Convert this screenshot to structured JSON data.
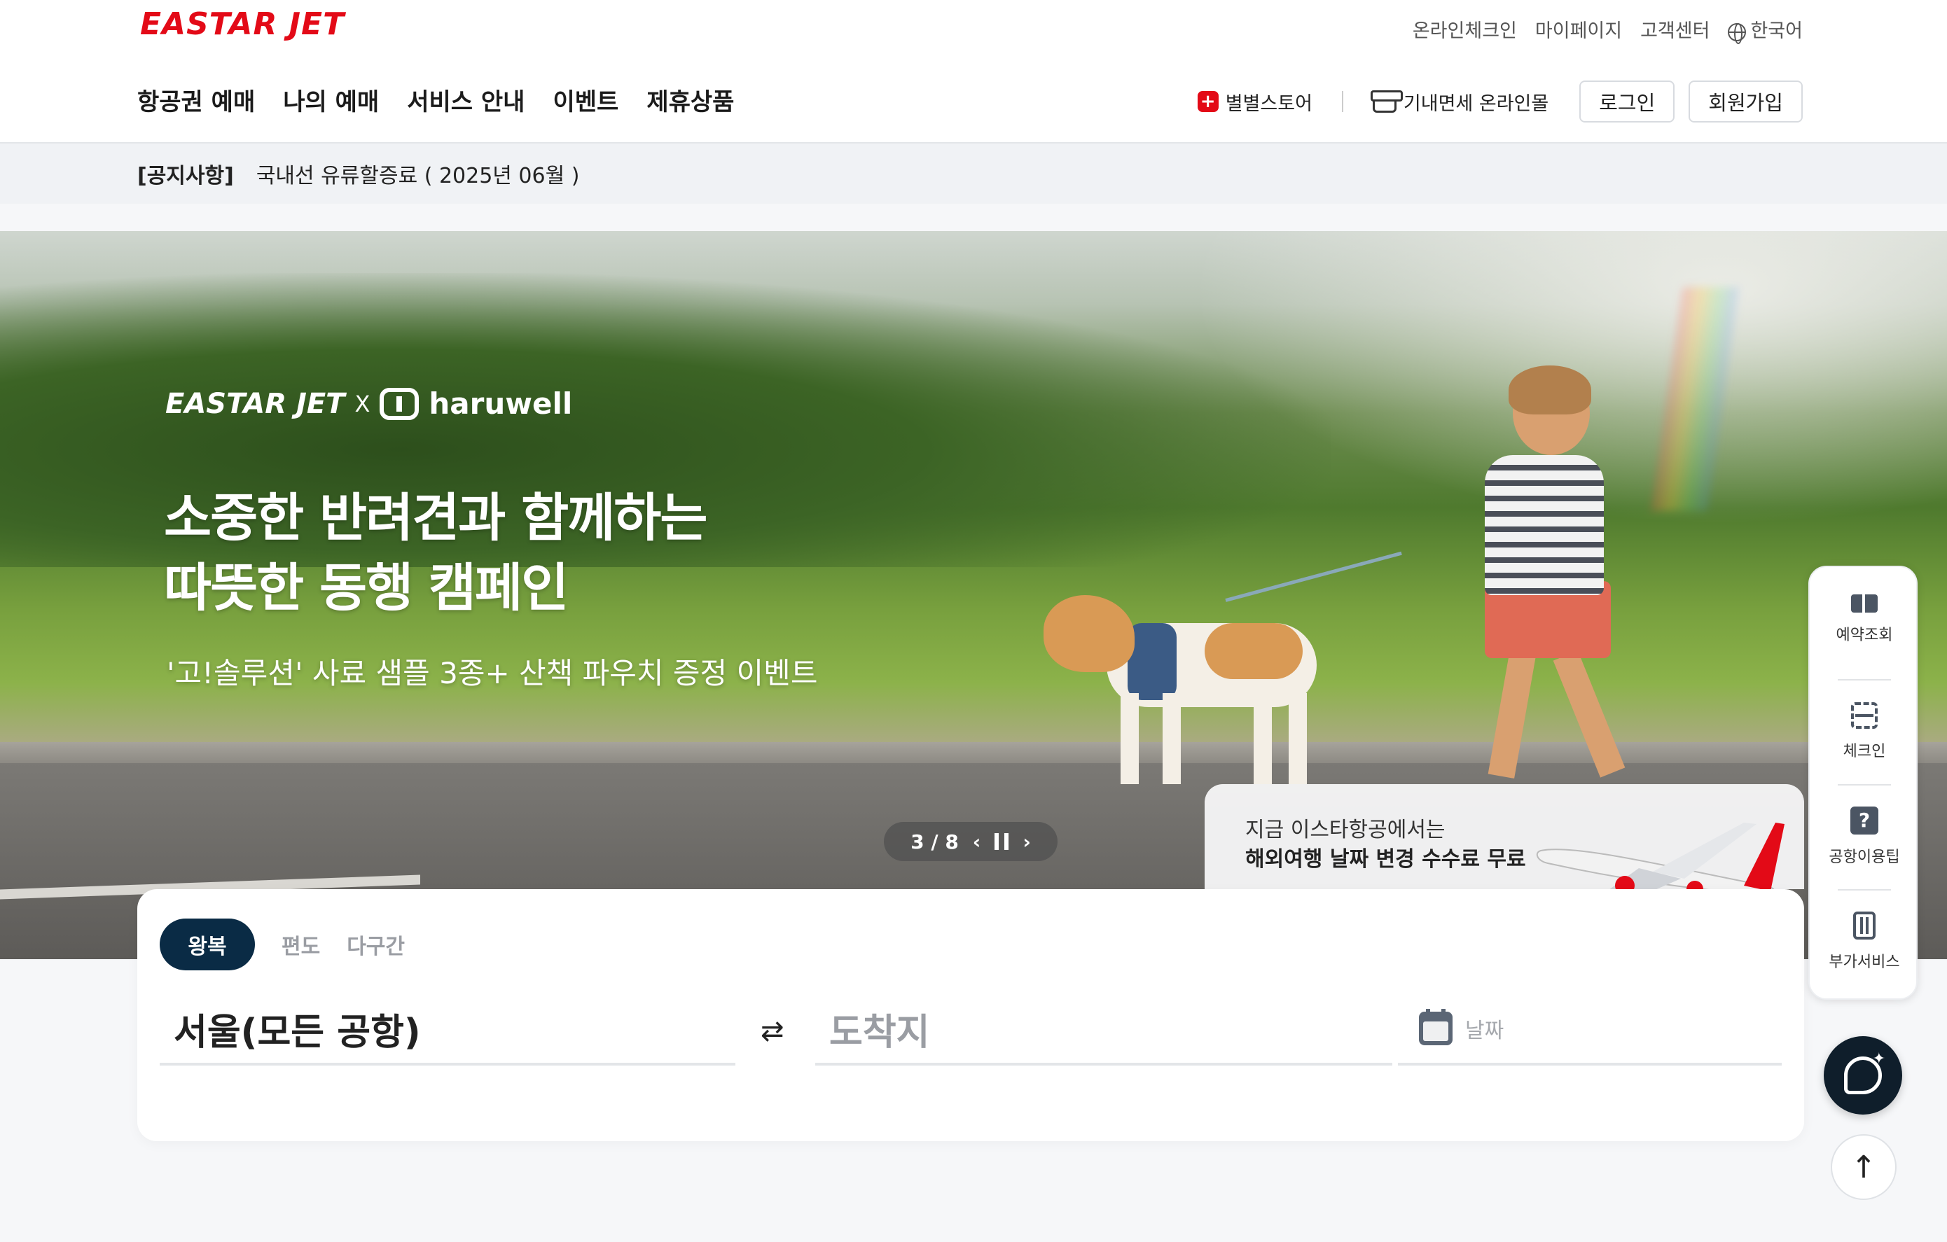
{
  "header": {
    "logo_text": "EASTAR JET",
    "utility_links": [
      "온라인체크인",
      "마이페이지",
      "고객센터"
    ],
    "language": "한국어",
    "nav": [
      "항공권 예매",
      "나의 예매",
      "서비스 안내",
      "이벤트",
      "제휴상품"
    ],
    "store_label": "별별스토어",
    "dutyfree_label": "기내면세 온라인몰",
    "login_label": "로그인",
    "signup_label": "회원가입"
  },
  "notice": {
    "label": "[공지사항]",
    "text": "국내선 유류할증료 ( 2025년 06월 )"
  },
  "banner": {
    "brand_1": "EASTAR JET",
    "brand_x": "X",
    "brand_2": "haruwell",
    "headline_1": "소중한 반려견과 함께하는",
    "headline_2": "따뜻한 동행 캠페인",
    "subtitle": "'고!솔루션' 사료 샘플 3종+ 산책 파우치 증정 이벤트",
    "pager": "3 / 8",
    "prev": "‹",
    "next": "›"
  },
  "promo": {
    "line1": "지금 이스타항공에서는",
    "line2": "해외여행 날짜 변경 수수료 무료"
  },
  "booking": {
    "tabs": [
      "왕복",
      "편도",
      "다구간"
    ],
    "from": "서울(모든 공항)",
    "swap": "⇄",
    "to_placeholder": "도착지",
    "date_placeholder": "날짜"
  },
  "quick_menu": [
    "예약조회",
    "체크인",
    "공항이용팁",
    "부가서비스"
  ],
  "to_top": "↑",
  "colors": {
    "brand_red": "#e30a17",
    "active_tab": "#0a2b45",
    "chatbot": "#0f1e2b"
  }
}
